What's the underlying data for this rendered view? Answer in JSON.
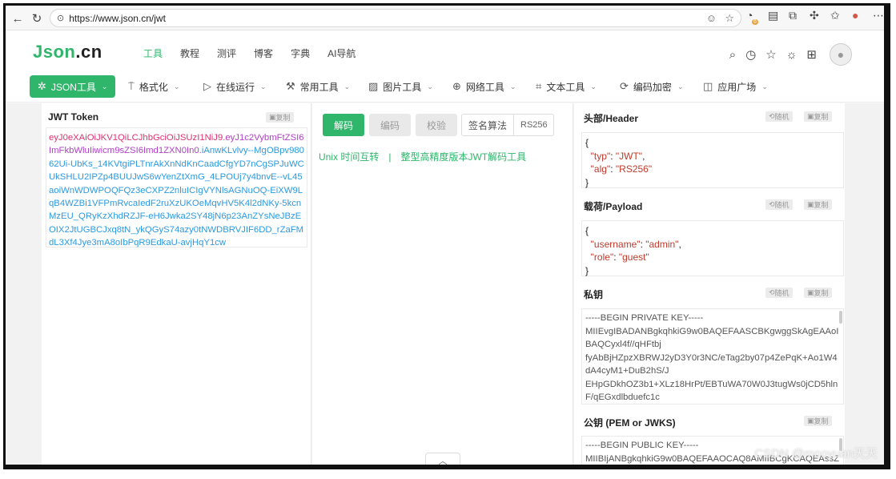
{
  "browser": {
    "url": "https://www.json.cn/jwt",
    "badge": "6"
  },
  "site": {
    "logo_json": "Json",
    "logo_cn": ".cn",
    "nav": [
      "工具",
      "教程",
      "测评",
      "博客",
      "字典",
      "AI导航"
    ]
  },
  "toolbar": {
    "items": [
      {
        "label": "JSON工具",
        "icon": "sparkle-icon"
      },
      {
        "label": "格式化",
        "icon": "brush-icon"
      },
      {
        "label": "在线运行",
        "icon": "play-icon"
      },
      {
        "label": "常用工具",
        "icon": "hammer-icon"
      },
      {
        "label": "图片工具",
        "icon": "image-icon"
      },
      {
        "label": "网络工具",
        "icon": "globe-icon"
      },
      {
        "label": "文本工具",
        "icon": "crop-icon"
      },
      {
        "label": "编码加密",
        "icon": "refresh-icon"
      },
      {
        "label": "应用广场",
        "icon": "app-icon"
      }
    ]
  },
  "left": {
    "title": "JWT Token",
    "copy": "复制",
    "token_header": "eyJ0eXAiOiJKV1QiLCJhbGciOiJSUzI1NiJ9",
    "token_payload": "eyJ1c2VybmFtZSI6ImFkbWluIiwicm9sZSI6Imd1ZXN0In0",
    "token_signature": "iAnwKLvlvy--MgOBpv98062Ui-UbKs_14KVtgiPLTnrAkXnNdKnCaadCfgYD7nCgSPJuWCUkSHLU2IPZp4BUUJwS6wYenZtXmG_4LPOUj7y4bnvE--vL45aoiWnWDWPOQFQz3eCXPZ2nluICIgVYNlsAGNuOQ-EiXW9LqB4WZBi1VFPmRvcaIedF2ruXzUKOeMqvHV5K4l2dNKy-5kcnMzEU_QRyKzXhdRZJF-eH6Jwka2SY48jN6p23AnZYsNeJBzEOIX2JtUGBCJxq8tN_ykQGyS74azy0tNWDBRVJIF6DD_rZaFMdL3Xf4Jye3mA8oIbPqR9EdkaU-avjHqY1cw",
    "dot": "."
  },
  "mid": {
    "btn_decode": "解码",
    "btn_encode": "编码",
    "btn_verify": "校验",
    "algo_label": "签名算法",
    "algo_value": "RS256",
    "link1": "Unix 时间互转",
    "sep": "|",
    "link2": "整型高精度版本JWT解码工具"
  },
  "right": {
    "header_title": "头部/Header",
    "payload_title": "载荷/Payload",
    "private_title": "私钥",
    "public_title": "公钥 (PEM or JWKS)",
    "random": "随机",
    "copy": "复制",
    "header_json": {
      "k1": "\"typ\"",
      "v1": "\"JWT\"",
      "k2": "\"alg\"",
      "v2": "\"RS256\""
    },
    "payload_json": {
      "k1": "\"username\"",
      "v1": "\"admin\"",
      "k2": "\"role\"",
      "v2": "\"guest\""
    },
    "private_key": [
      "-----BEGIN PRIVATE KEY-----",
      "MIIEvgIBADANBgkqhkiG9w0BAQEFAASCBKgwggSkAgEAAoIBAQCyxl4f//qHFtbj",
      "fyAbBjHZpzXBRWJ2yD3Y0r3NC/eTag2by07p4ZePqK+Ao1W4dA4cyM1+DuB2hS/J",
      "EHpGDkhOZ3b1+XLz18HrPt/EBTuWA70W0J3tugWs0jCD5hlnF/qEGxdlbduefc1c"
    ],
    "public_key": [
      "-----BEGIN PUBLIC KEY-----",
      "MIIBIjANBgkqhkiG9w0BAQEFAAOCAQ8AMIIBCgKCAQEAssZe"
    ]
  },
  "watermark": "CSDN @mooyuan天天"
}
